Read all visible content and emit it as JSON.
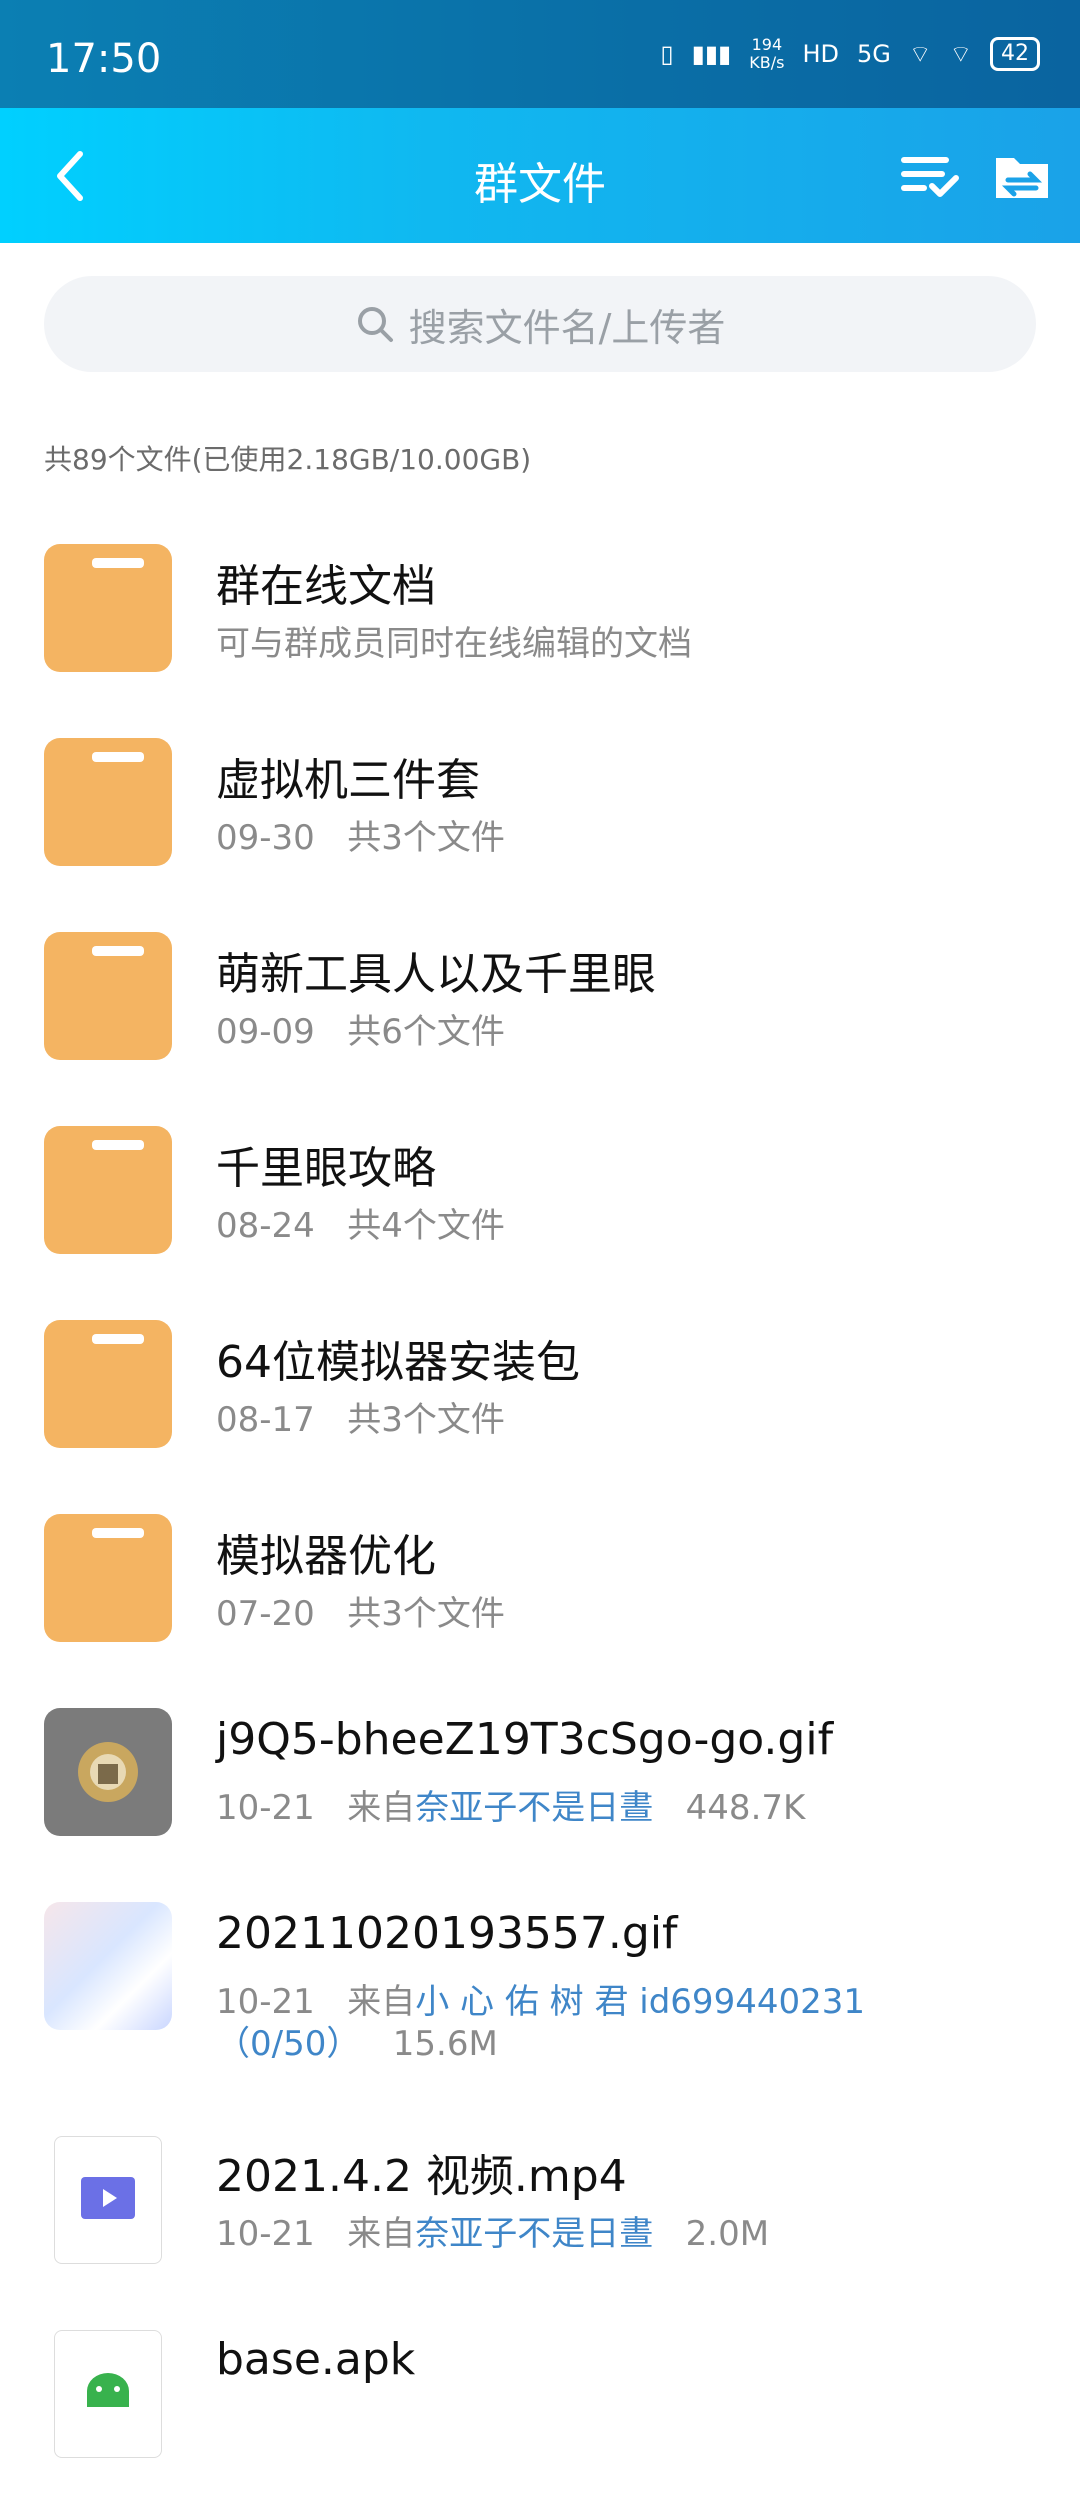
{
  "status_bar": {
    "time": "17:50",
    "speed_value": "194",
    "speed_unit": "KB/s",
    "hd": "HD",
    "net": "5G",
    "battery": "42"
  },
  "app_bar": {
    "title": "群文件"
  },
  "search": {
    "placeholder": "搜索文件名/上传者"
  },
  "summary": "共89个文件(已使用2.18GB/10.00GB)",
  "items": [
    {
      "type": "folder",
      "name": "群在线文档",
      "meta": "可与群成员同时在线编辑的文档"
    },
    {
      "type": "folder",
      "name": "虚拟机三件套",
      "date": "09-30",
      "count": "共3个文件"
    },
    {
      "type": "folder",
      "name": "萌新工具人以及千里眼",
      "date": "09-09",
      "count": "共6个文件"
    },
    {
      "type": "folder",
      "name": "千里眼攻略",
      "date": "08-24",
      "count": "共4个文件"
    },
    {
      "type": "folder",
      "name": "64位模拟器安装包",
      "date": "08-17",
      "count": "共3个文件"
    },
    {
      "type": "folder",
      "name": "模拟器优化",
      "date": "07-20",
      "count": "共3个文件"
    },
    {
      "type": "gif",
      "name": "j9Q5-bheeZ19T3cSgo-go.gif",
      "date": "10-21",
      "from_prefix": "来自",
      "uploader": "奈亚子不是日晝",
      "size": "448.7K"
    },
    {
      "type": "gif-photo",
      "name": "20211020193557.gif",
      "date": "10-21",
      "from_prefix": "来自",
      "uploader": "小 心 佑 树 君 id699440231",
      "uploader_line2": "（0/50）",
      "size": "15.6M"
    },
    {
      "type": "video",
      "name": "2021.4.2 视频.mp4",
      "date": "10-21",
      "from_prefix": "来自",
      "uploader": "奈亚子不是日晝",
      "size": "2.0M"
    },
    {
      "type": "apk",
      "name": "base.apk"
    }
  ],
  "colors": {
    "accent": "#1aa2e8",
    "folder": "#f4b462",
    "link": "#3f86c8"
  }
}
